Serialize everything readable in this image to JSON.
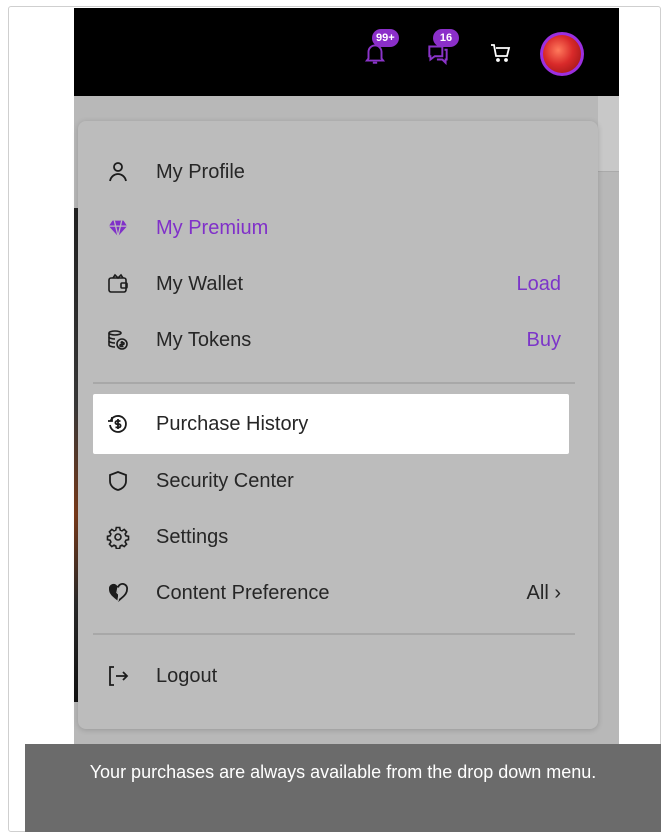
{
  "topbar": {
    "notifications_badge": "99+",
    "messages_badge": "16"
  },
  "menu": {
    "items": [
      {
        "label": "My Profile",
        "icon": "user-icon",
        "action": ""
      },
      {
        "label": "My Premium",
        "icon": "diamond-icon",
        "action": ""
      },
      {
        "label": "My Wallet",
        "icon": "wallet-icon",
        "action": "Load"
      },
      {
        "label": "My Tokens",
        "icon": "tokens-icon",
        "action": "Buy"
      },
      {
        "label": "Purchase History",
        "icon": "purchase-history-icon",
        "action": ""
      },
      {
        "label": "Security Center",
        "icon": "shield-icon",
        "action": ""
      },
      {
        "label": "Settings",
        "icon": "gear-icon",
        "action": ""
      },
      {
        "label": "Content Preference",
        "icon": "heart-half-icon",
        "action": "All ›"
      },
      {
        "label": "Logout",
        "icon": "logout-icon",
        "action": ""
      }
    ]
  },
  "tooltip": {
    "text": "Your purchases are always available from the drop down menu."
  },
  "colors": {
    "accent": "#8030c9",
    "overlay": "#bcbcbc",
    "tooltip_bg": "#6b6b6b"
  }
}
